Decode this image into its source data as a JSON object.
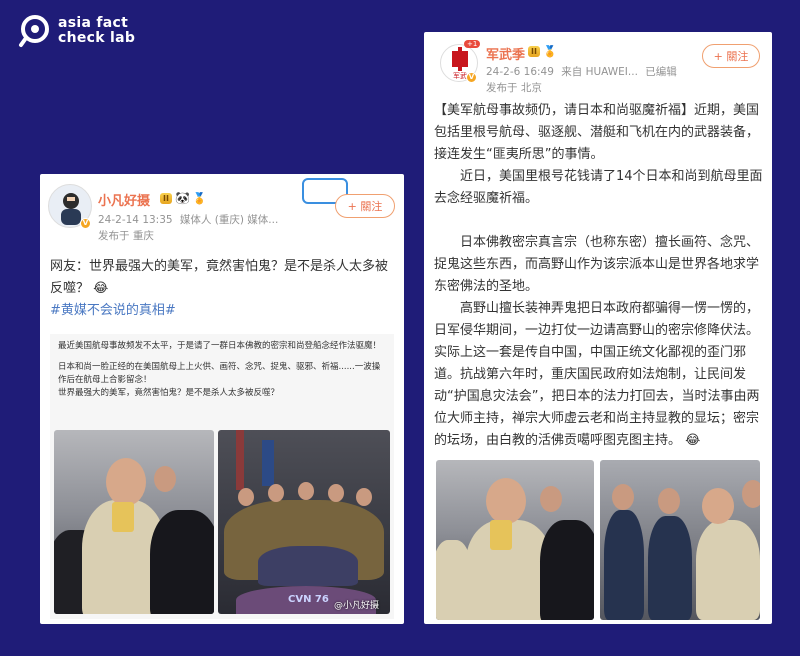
{
  "brand": {
    "line1": "asia fact",
    "line2": "check lab"
  },
  "left_post": {
    "username": "小凡好摄",
    "level": "II",
    "meta_time": "24-2-14 13:35",
    "meta_source": "媒体人 (重庆) 媒体...",
    "meta_location": "发布于 重庆",
    "follow_label": "+ 關注",
    "text": "网友：世界最强大的美军，竟然害怕鬼？是不是杀人太多被反噬？",
    "emoji": "😂",
    "hashtag": "#黄媒不会说的真相#",
    "inner_lines": [
      "最近美国航母事故频发不太平，于是请了一群日本佛教的密宗和尚登船念经作法驱魔！",
      "",
      "日本和尚一脸正经的在美国航母上上火供、画符、念咒、捉鬼、驱邪、祈福......一波操作后在航母上合影留念！",
      "世界最强大的美军，竟然害怕鬼？是不是杀人太多被反噬？"
    ],
    "watermark": "@小凡好摄",
    "ship_text": "CVN 76"
  },
  "right_post": {
    "username": "军武季",
    "level": "II",
    "meta_time": "24-2-6 16:49",
    "meta_source": "来自 HUAWEI...",
    "meta_edited": "已编辑",
    "meta_location": "发布于 北京",
    "follow_label": "+ 關注",
    "para1": "【美军航母事故频仍，请日本和尚驱魔祈福】近期，美国包括里根号航母、驱逐舰、潜艇和飞机在内的武器装备，接连发生“匪夷所思”的事情。",
    "para2": "近日，美国里根号花钱请了14个日本和尚到航母里面去念经驱魔祈福。",
    "para3": "日本佛教密宗真言宗（也称东密）擅长画符、念咒、捉鬼这些东西，而高野山作为该宗派本山是世界各地求学东密佛法的圣地。",
    "para4": "高野山擅长装神弄鬼把日本政府都骗得一愣一愣的，日军侵华期间，一边打仗一边请高野山的密宗修降伏法。实际上这一套是传自中国，中国正统文化鄙视的歪门邪道。抗战第六年时，重庆国民政府如法炮制，让民间发动“护国息灾法会”，把日本的法力打回去，当时法事由两位大师主持，禅宗大师虚云老和尚主持显教的显坛；密宗的坛场，由白教的活佛贡噶呼图克图主持。",
    "emoji": "😂"
  }
}
